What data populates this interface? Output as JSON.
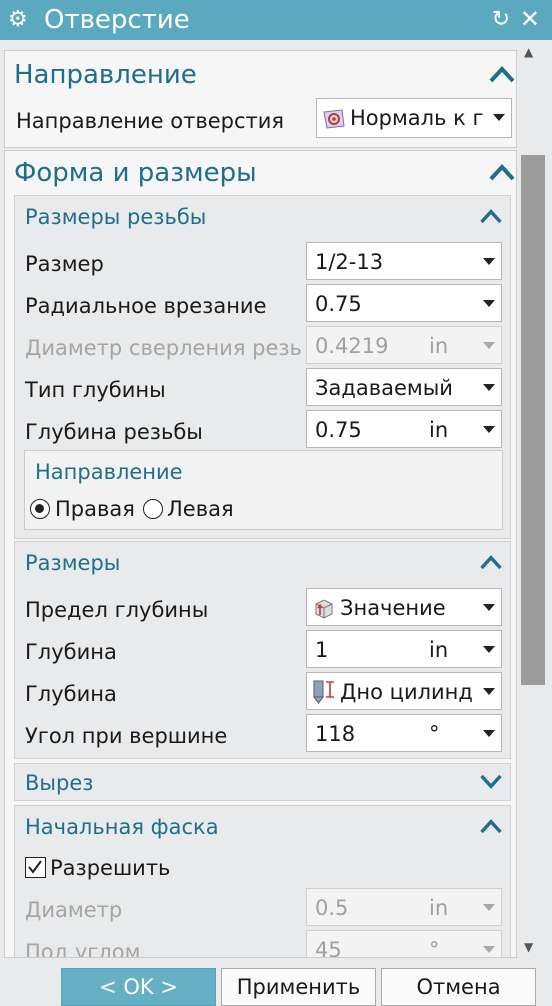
{
  "window": {
    "title": "Отверстие",
    "reset_icon": "↻",
    "close_icon": "✕",
    "settings_icon": "⚙"
  },
  "direction_section": {
    "title": "Направление",
    "label": "Направление отверстия",
    "value": "Нормаль к г",
    "icon": "normal-direction-icon"
  },
  "shape_section": {
    "title": "Форма и размеры",
    "thread": {
      "title": "Размеры резьбы",
      "size": {
        "label": "Размер",
        "value": "1/2-13"
      },
      "radial": {
        "label": "Радиальное врезание",
        "value": "0.75"
      },
      "drill_dia": {
        "label": "Диаметр сверления резьбы",
        "value": "0.4219",
        "unit": "in"
      },
      "depth_type": {
        "label": "Тип глубины",
        "value": "Задаваемый"
      },
      "thread_depth": {
        "label": "Глубина резьбы",
        "value": "0.75",
        "unit": "in"
      },
      "hand": {
        "title": "Направление",
        "right": "Правая",
        "left": "Левая",
        "selected": "Правая"
      }
    },
    "dimensions": {
      "title": "Размеры",
      "depth_limit": {
        "label": "Предел глубины",
        "value": "Значение"
      },
      "depth": {
        "label": "Глубина",
        "value": "1",
        "unit": "in"
      },
      "depth_to": {
        "label": "Глубина",
        "value": "Дно цилинд"
      },
      "tip_angle": {
        "label": "Угол при вершине",
        "value": "118",
        "unit": "°"
      }
    },
    "relief": {
      "title": "Вырез"
    },
    "start_chamfer": {
      "title": "Начальная фаска",
      "enable": {
        "label": "Разрешить",
        "checked": true
      },
      "diameter": {
        "label": "Диаметр",
        "value": "0.5",
        "unit": "in"
      },
      "angle": {
        "label": "Под углом",
        "value": "45",
        "unit": "°"
      }
    }
  },
  "buttons": {
    "ok": "< OK >",
    "apply": "Применить",
    "cancel": "Отмена"
  },
  "colors": {
    "titlebar": "#5aa9c0",
    "section_title": "#1f6f8b",
    "ok_button": "#66b0c6"
  }
}
